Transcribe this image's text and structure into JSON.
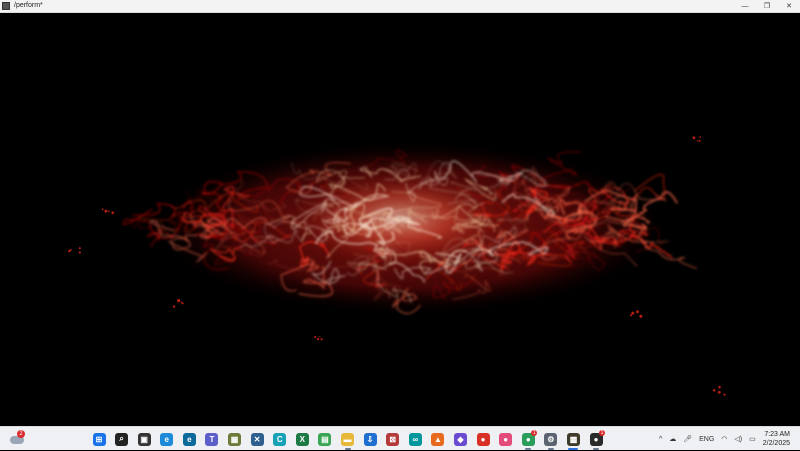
{
  "window": {
    "title": "/perform*",
    "controls": {
      "minimize": "—",
      "restore": "❐",
      "close": "✕"
    }
  },
  "visualization": {
    "palette": [
      "#8b0000",
      "#d01010",
      "#ff2a1a",
      "#ff6a4a",
      "#f2d2a2",
      "#fff2dc"
    ]
  },
  "taskbar": {
    "weather": {
      "badge": "2",
      "icon": "cloud-weather-icon"
    },
    "apps": [
      {
        "name": "windows-start-icon",
        "glyph": "⊞",
        "color": "#1a73e8",
        "active": false
      },
      {
        "name": "search-icon",
        "glyph": "⌕",
        "color": "#222222",
        "active": false
      },
      {
        "name": "task-view-icon",
        "glyph": "▣",
        "color": "#333333",
        "active": false
      },
      {
        "name": "edge-browser-icon",
        "glyph": "e",
        "color": "#1c8ad9",
        "active": false
      },
      {
        "name": "edge-dev-icon",
        "glyph": "e",
        "color": "#0b6a9a",
        "active": false
      },
      {
        "name": "teams-icon",
        "glyph": "T",
        "color": "#5b5fc7",
        "active": false
      },
      {
        "name": "photo-viewer-icon",
        "glyph": "▦",
        "color": "#6b7b3a",
        "active": false
      },
      {
        "name": "app-icon-x",
        "glyph": "✕",
        "color": "#2f5f8f",
        "active": false
      },
      {
        "name": "app-icon-c",
        "glyph": "C",
        "color": "#17a2b8",
        "active": false
      },
      {
        "name": "excel-icon",
        "glyph": "X",
        "color": "#1d7a44",
        "active": false
      },
      {
        "name": "notes-icon",
        "glyph": "▤",
        "color": "#3aa655",
        "active": false
      },
      {
        "name": "file-explorer-icon",
        "glyph": "▬",
        "color": "#e6b93a",
        "active": true
      },
      {
        "name": "download-app-icon",
        "glyph": "⇩",
        "color": "#1f6fd1",
        "active": false
      },
      {
        "name": "grid-app-icon",
        "glyph": "⊠",
        "color": "#b53a3a",
        "active": false
      },
      {
        "name": "arduino-icon",
        "glyph": "∞",
        "color": "#00979c",
        "active": false
      },
      {
        "name": "office-icon",
        "glyph": "▲",
        "color": "#e86a1f",
        "active": false
      },
      {
        "name": "purple-app-icon",
        "glyph": "◆",
        "color": "#6b4bcf",
        "active": false
      },
      {
        "name": "chrome-icon",
        "glyph": "●",
        "color": "#d93025",
        "active": false
      },
      {
        "name": "chrome-profile-icon",
        "glyph": "●",
        "color": "#e24b7a",
        "active": false
      },
      {
        "name": "chrome-alt-icon",
        "glyph": "●",
        "color": "#2a9d5a",
        "active": true,
        "badge": "1"
      },
      {
        "name": "settings-icon",
        "glyph": "⚙",
        "color": "#5b6470",
        "active": true
      },
      {
        "name": "processing-app-icon",
        "glyph": "▩",
        "color": "#3f3a2a",
        "active": true,
        "focused": true
      },
      {
        "name": "media-app-icon",
        "glyph": "●",
        "color": "#2a2a2a",
        "active": true,
        "badge": "1"
      }
    ],
    "tray": {
      "overflow": "^",
      "language": "ENG",
      "time": "7:23 AM",
      "date": "2/2/2025"
    }
  }
}
